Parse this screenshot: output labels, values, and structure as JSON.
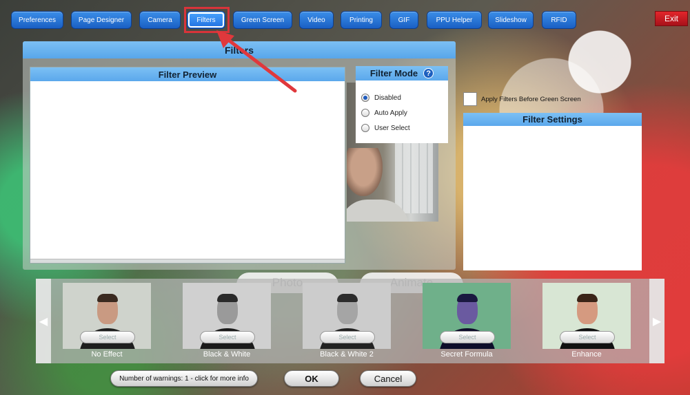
{
  "tabs": [
    {
      "label": "Preferences",
      "active": false
    },
    {
      "label": "Page Designer",
      "active": false
    },
    {
      "label": "Camera",
      "active": false
    },
    {
      "label": "Filters",
      "active": true
    },
    {
      "label": "Green Screen",
      "active": false
    },
    {
      "label": "Video",
      "active": false
    },
    {
      "label": "Printing",
      "active": false
    },
    {
      "label": "GIF",
      "active": false
    },
    {
      "label": "PPU Helper",
      "active": false
    },
    {
      "label": "Slideshow",
      "active": false
    },
    {
      "label": "RFID",
      "active": false
    }
  ],
  "exit_label": "Exit",
  "main": {
    "title": "Filters",
    "preview_title": "Filter Preview",
    "mode": {
      "title": "Filter Mode",
      "help_icon": "?",
      "options": [
        {
          "label": "Disabled",
          "checked": true
        },
        {
          "label": "Auto Apply",
          "checked": false
        },
        {
          "label": "User Select",
          "checked": false
        }
      ]
    }
  },
  "apply_before_green_screen": {
    "label": "Apply Filters Before Green Screen",
    "checked": false
  },
  "settings_title": "Filter Settings",
  "ghost_tabs": [
    "Photo",
    "Animate"
  ],
  "carousel": {
    "prev_icon": "◀",
    "next_icon": "▶",
    "select_label": "Select",
    "filters": [
      {
        "label": "No Effect",
        "palette": {
          "bg": "#cfd3cc",
          "skin": "#c99a82",
          "hair": "#3a2a20",
          "shirt": "#1e1e1e"
        }
      },
      {
        "label": "Black & White",
        "palette": {
          "bg": "#d0d0d0",
          "skin": "#9a9a9a",
          "hair": "#2a2a2a",
          "shirt": "#1a1a1a"
        }
      },
      {
        "label": "Black & White 2",
        "palette": {
          "bg": "#cccccc",
          "skin": "#a5a5a5",
          "hair": "#2c2c2c",
          "shirt": "#222222"
        }
      },
      {
        "label": "Secret Formula",
        "palette": {
          "bg": "#6fb08a",
          "skin": "#6a5aa0",
          "hair": "#1a1840",
          "shirt": "#0d0d2a"
        }
      },
      {
        "label": "Enhance",
        "palette": {
          "bg": "#d8e6d4",
          "skin": "#d59a80",
          "hair": "#3a2418",
          "shirt": "#111111"
        }
      }
    ]
  },
  "footer": {
    "warnings_label": "Number of warnings: 1 - click for more info",
    "ok_label": "OK",
    "cancel_label": "Cancel"
  }
}
